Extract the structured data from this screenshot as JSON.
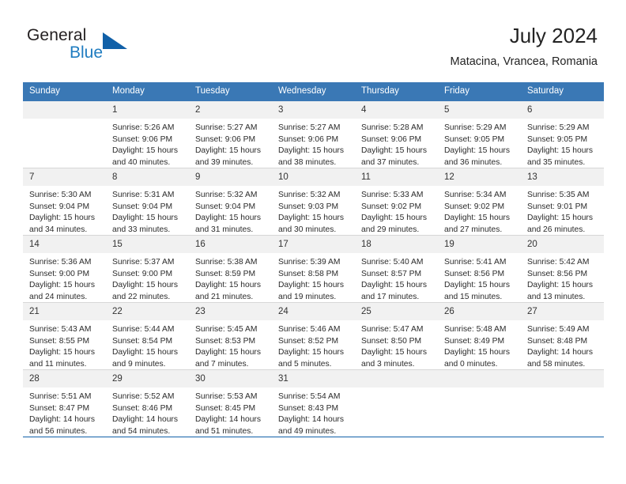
{
  "brand": {
    "name_part1": "General",
    "name_part2": "Blue",
    "triangle_icon": "triangle-icon",
    "accent_color": "#1160a8",
    "blue_text_color": "#1f7cc0"
  },
  "header": {
    "title": "July 2024",
    "subtitle": "Matacina, Vrancea, Romania"
  },
  "colors": {
    "header_row_bg": "#3a78b5",
    "daynum_bg": "#f1f1f1",
    "row_divider": "#d7d7d7",
    "last_row_divider": "#1160a8",
    "text": "#2b2b2b"
  },
  "calendar": {
    "weekday_headers": [
      "Sunday",
      "Monday",
      "Tuesday",
      "Wednesday",
      "Thursday",
      "Friday",
      "Saturday"
    ],
    "weeks": [
      [
        {
          "day": "",
          "sunrise": "",
          "sunset": "",
          "daylight_line1": "",
          "daylight_line2": "",
          "empty": true
        },
        {
          "day": "1",
          "sunrise": "Sunrise: 5:26 AM",
          "sunset": "Sunset: 9:06 PM",
          "daylight_line1": "Daylight: 15 hours",
          "daylight_line2": "and 40 minutes.",
          "empty": false
        },
        {
          "day": "2",
          "sunrise": "Sunrise: 5:27 AM",
          "sunset": "Sunset: 9:06 PM",
          "daylight_line1": "Daylight: 15 hours",
          "daylight_line2": "and 39 minutes.",
          "empty": false
        },
        {
          "day": "3",
          "sunrise": "Sunrise: 5:27 AM",
          "sunset": "Sunset: 9:06 PM",
          "daylight_line1": "Daylight: 15 hours",
          "daylight_line2": "and 38 minutes.",
          "empty": false
        },
        {
          "day": "4",
          "sunrise": "Sunrise: 5:28 AM",
          "sunset": "Sunset: 9:06 PM",
          "daylight_line1": "Daylight: 15 hours",
          "daylight_line2": "and 37 minutes.",
          "empty": false
        },
        {
          "day": "5",
          "sunrise": "Sunrise: 5:29 AM",
          "sunset": "Sunset: 9:05 PM",
          "daylight_line1": "Daylight: 15 hours",
          "daylight_line2": "and 36 minutes.",
          "empty": false
        },
        {
          "day": "6",
          "sunrise": "Sunrise: 5:29 AM",
          "sunset": "Sunset: 9:05 PM",
          "daylight_line1": "Daylight: 15 hours",
          "daylight_line2": "and 35 minutes.",
          "empty": false
        }
      ],
      [
        {
          "day": "7",
          "sunrise": "Sunrise: 5:30 AM",
          "sunset": "Sunset: 9:04 PM",
          "daylight_line1": "Daylight: 15 hours",
          "daylight_line2": "and 34 minutes.",
          "empty": false
        },
        {
          "day": "8",
          "sunrise": "Sunrise: 5:31 AM",
          "sunset": "Sunset: 9:04 PM",
          "daylight_line1": "Daylight: 15 hours",
          "daylight_line2": "and 33 minutes.",
          "empty": false
        },
        {
          "day": "9",
          "sunrise": "Sunrise: 5:32 AM",
          "sunset": "Sunset: 9:04 PM",
          "daylight_line1": "Daylight: 15 hours",
          "daylight_line2": "and 31 minutes.",
          "empty": false
        },
        {
          "day": "10",
          "sunrise": "Sunrise: 5:32 AM",
          "sunset": "Sunset: 9:03 PM",
          "daylight_line1": "Daylight: 15 hours",
          "daylight_line2": "and 30 minutes.",
          "empty": false
        },
        {
          "day": "11",
          "sunrise": "Sunrise: 5:33 AM",
          "sunset": "Sunset: 9:02 PM",
          "daylight_line1": "Daylight: 15 hours",
          "daylight_line2": "and 29 minutes.",
          "empty": false
        },
        {
          "day": "12",
          "sunrise": "Sunrise: 5:34 AM",
          "sunset": "Sunset: 9:02 PM",
          "daylight_line1": "Daylight: 15 hours",
          "daylight_line2": "and 27 minutes.",
          "empty": false
        },
        {
          "day": "13",
          "sunrise": "Sunrise: 5:35 AM",
          "sunset": "Sunset: 9:01 PM",
          "daylight_line1": "Daylight: 15 hours",
          "daylight_line2": "and 26 minutes.",
          "empty": false
        }
      ],
      [
        {
          "day": "14",
          "sunrise": "Sunrise: 5:36 AM",
          "sunset": "Sunset: 9:00 PM",
          "daylight_line1": "Daylight: 15 hours",
          "daylight_line2": "and 24 minutes.",
          "empty": false
        },
        {
          "day": "15",
          "sunrise": "Sunrise: 5:37 AM",
          "sunset": "Sunset: 9:00 PM",
          "daylight_line1": "Daylight: 15 hours",
          "daylight_line2": "and 22 minutes.",
          "empty": false
        },
        {
          "day": "16",
          "sunrise": "Sunrise: 5:38 AM",
          "sunset": "Sunset: 8:59 PM",
          "daylight_line1": "Daylight: 15 hours",
          "daylight_line2": "and 21 minutes.",
          "empty": false
        },
        {
          "day": "17",
          "sunrise": "Sunrise: 5:39 AM",
          "sunset": "Sunset: 8:58 PM",
          "daylight_line1": "Daylight: 15 hours",
          "daylight_line2": "and 19 minutes.",
          "empty": false
        },
        {
          "day": "18",
          "sunrise": "Sunrise: 5:40 AM",
          "sunset": "Sunset: 8:57 PM",
          "daylight_line1": "Daylight: 15 hours",
          "daylight_line2": "and 17 minutes.",
          "empty": false
        },
        {
          "day": "19",
          "sunrise": "Sunrise: 5:41 AM",
          "sunset": "Sunset: 8:56 PM",
          "daylight_line1": "Daylight: 15 hours",
          "daylight_line2": "and 15 minutes.",
          "empty": false
        },
        {
          "day": "20",
          "sunrise": "Sunrise: 5:42 AM",
          "sunset": "Sunset: 8:56 PM",
          "daylight_line1": "Daylight: 15 hours",
          "daylight_line2": "and 13 minutes.",
          "empty": false
        }
      ],
      [
        {
          "day": "21",
          "sunrise": "Sunrise: 5:43 AM",
          "sunset": "Sunset: 8:55 PM",
          "daylight_line1": "Daylight: 15 hours",
          "daylight_line2": "and 11 minutes.",
          "empty": false
        },
        {
          "day": "22",
          "sunrise": "Sunrise: 5:44 AM",
          "sunset": "Sunset: 8:54 PM",
          "daylight_line1": "Daylight: 15 hours",
          "daylight_line2": "and 9 minutes.",
          "empty": false
        },
        {
          "day": "23",
          "sunrise": "Sunrise: 5:45 AM",
          "sunset": "Sunset: 8:53 PM",
          "daylight_line1": "Daylight: 15 hours",
          "daylight_line2": "and 7 minutes.",
          "empty": false
        },
        {
          "day": "24",
          "sunrise": "Sunrise: 5:46 AM",
          "sunset": "Sunset: 8:52 PM",
          "daylight_line1": "Daylight: 15 hours",
          "daylight_line2": "and 5 minutes.",
          "empty": false
        },
        {
          "day": "25",
          "sunrise": "Sunrise: 5:47 AM",
          "sunset": "Sunset: 8:50 PM",
          "daylight_line1": "Daylight: 15 hours",
          "daylight_line2": "and 3 minutes.",
          "empty": false
        },
        {
          "day": "26",
          "sunrise": "Sunrise: 5:48 AM",
          "sunset": "Sunset: 8:49 PM",
          "daylight_line1": "Daylight: 15 hours",
          "daylight_line2": "and 0 minutes.",
          "empty": false
        },
        {
          "day": "27",
          "sunrise": "Sunrise: 5:49 AM",
          "sunset": "Sunset: 8:48 PM",
          "daylight_line1": "Daylight: 14 hours",
          "daylight_line2": "and 58 minutes.",
          "empty": false
        }
      ],
      [
        {
          "day": "28",
          "sunrise": "Sunrise: 5:51 AM",
          "sunset": "Sunset: 8:47 PM",
          "daylight_line1": "Daylight: 14 hours",
          "daylight_line2": "and 56 minutes.",
          "empty": false
        },
        {
          "day": "29",
          "sunrise": "Sunrise: 5:52 AM",
          "sunset": "Sunset: 8:46 PM",
          "daylight_line1": "Daylight: 14 hours",
          "daylight_line2": "and 54 minutes.",
          "empty": false
        },
        {
          "day": "30",
          "sunrise": "Sunrise: 5:53 AM",
          "sunset": "Sunset: 8:45 PM",
          "daylight_line1": "Daylight: 14 hours",
          "daylight_line2": "and 51 minutes.",
          "empty": false
        },
        {
          "day": "31",
          "sunrise": "Sunrise: 5:54 AM",
          "sunset": "Sunset: 8:43 PM",
          "daylight_line1": "Daylight: 14 hours",
          "daylight_line2": "and 49 minutes.",
          "empty": false
        },
        {
          "day": "",
          "sunrise": "",
          "sunset": "",
          "daylight_line1": "",
          "daylight_line2": "",
          "empty": true
        },
        {
          "day": "",
          "sunrise": "",
          "sunset": "",
          "daylight_line1": "",
          "daylight_line2": "",
          "empty": true
        },
        {
          "day": "",
          "sunrise": "",
          "sunset": "",
          "daylight_line1": "",
          "daylight_line2": "",
          "empty": true
        }
      ]
    ]
  }
}
